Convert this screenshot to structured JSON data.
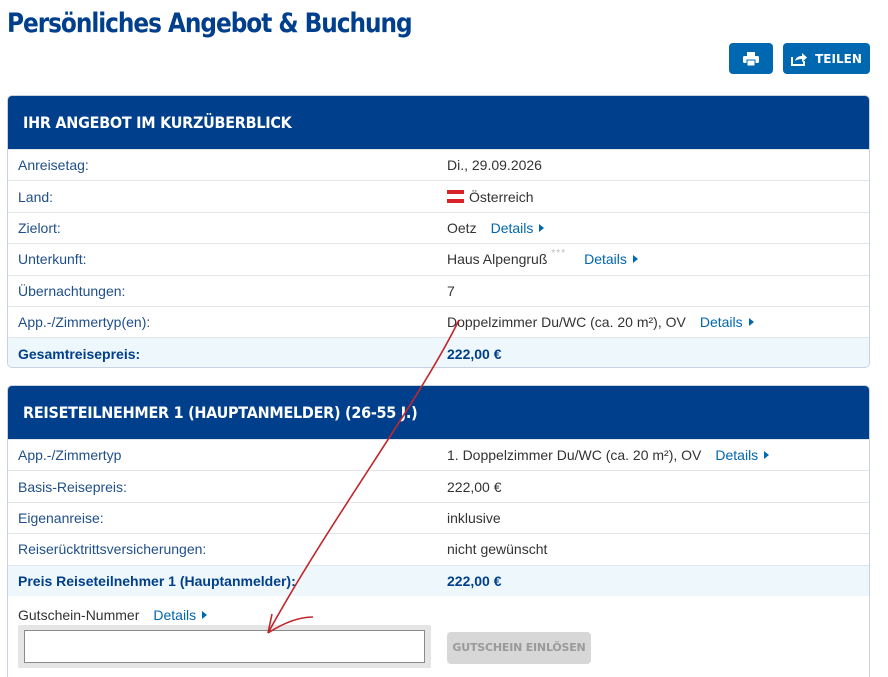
{
  "page": {
    "title": "Persönliches Angebot & Buchung"
  },
  "toolbar": {
    "print_icon": "printer-icon",
    "share_icon": "share-icon",
    "share_label": "TEILEN",
    "accent": "#0067b1"
  },
  "offer": {
    "heading": "IHR ANGEBOT IM KURZÜBERBLICK",
    "rows": [
      {
        "label": "Anreisetag:",
        "value": "Di., 29.09.2026"
      },
      {
        "label": "Land:",
        "value": "Österreich"
      },
      {
        "label": "Zielort:",
        "value": "Oetz",
        "details": "Details"
      },
      {
        "label": "Unterkunft:",
        "value": "Haus Alpengruß",
        "stars": "***",
        "details": "Details"
      },
      {
        "label": "Übernachtungen:",
        "value": "7"
      },
      {
        "label": "App.-/Zimmertyp(en):",
        "value": "Doppelzimmer Du/WC (ca. 20 m²), OV",
        "details": "Details"
      }
    ],
    "total": {
      "label": "Gesamtreisepreis:",
      "value": "222,00 €"
    }
  },
  "participant": {
    "heading": "REISETEILNEHMER 1 (HAUPTANMELDER) (26-55 J.)",
    "rows": [
      {
        "label": "App.-/Zimmertyp",
        "value": "1. Doppelzimmer Du/WC (ca. 20 m²), OV",
        "details": "Details"
      },
      {
        "label": "Basis-Reisepreis:",
        "value": "222,00 €"
      },
      {
        "label": "Eigenanreise:",
        "value": "inklusive"
      },
      {
        "label": "Reiserücktrittsversicherungen:",
        "value": "nicht gewünscht"
      }
    ],
    "total": {
      "label": "Preis Reiseteilnehmer 1 (Hauptanmelder):",
      "value": "222,00 €"
    }
  },
  "voucher": {
    "label": "Gutschein-Nummer",
    "details": "Details",
    "value": "",
    "placeholder": "",
    "button": "GUTSCHEIN EINLÖSEN"
  },
  "colors": {
    "brand": "#003f8c",
    "total_bg": "#eef7fb",
    "annotation_arrow": "#c0272d"
  }
}
